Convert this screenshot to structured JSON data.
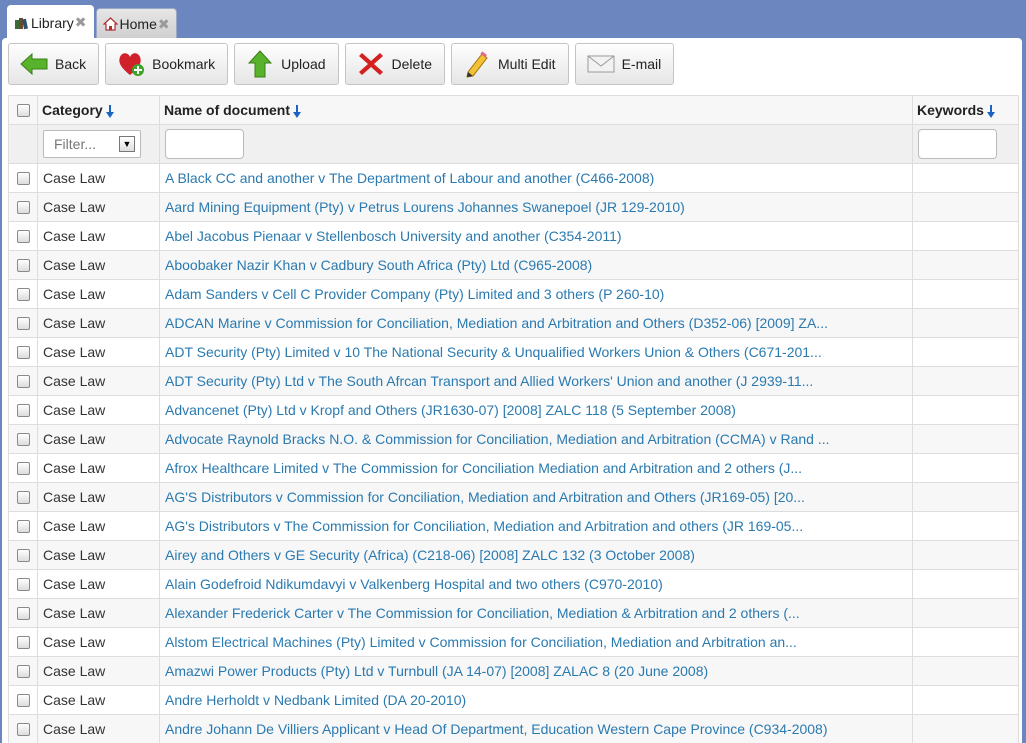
{
  "tabs": [
    {
      "label": "Library",
      "icon": "books-icon",
      "active": true
    },
    {
      "label": "Home",
      "icon": "house-icon",
      "active": false
    }
  ],
  "toolbar": [
    {
      "label": "Back",
      "icon": "back-arrow-icon"
    },
    {
      "label": "Bookmark",
      "icon": "heart-add-icon"
    },
    {
      "label": "Upload",
      "icon": "upload-arrow-icon"
    },
    {
      "label": "Delete",
      "icon": "delete-x-icon"
    },
    {
      "label": "Multi Edit",
      "icon": "pencil-icon"
    },
    {
      "label": "E-mail",
      "icon": "envelope-icon"
    }
  ],
  "table": {
    "headers": {
      "category": "Category",
      "name": "Name of document",
      "keywords": "Keywords"
    },
    "filter_placeholder": "Filter...",
    "rows": [
      {
        "category": "Case Law",
        "name": "A Black CC and another v The Department of Labour and another (C466-2008)"
      },
      {
        "category": "Case Law",
        "name": "Aard Mining Equipment (Pty) v Petrus Lourens Johannes Swanepoel (JR 129-2010)"
      },
      {
        "category": "Case Law",
        "name": "Abel Jacobus Pienaar v Stellenbosch University and another (C354-2011)"
      },
      {
        "category": "Case Law",
        "name": "Aboobaker Nazir Khan v Cadbury South Africa (Pty) Ltd (C965-2008)"
      },
      {
        "category": "Case Law",
        "name": "Adam Sanders v Cell C Provider Company (Pty) Limited and 3 others (P 260-10)"
      },
      {
        "category": "Case Law",
        "name": "ADCAN Marine v Commission for Conciliation, Mediation and Arbitration and Others (D352-06) [2009] ZA..."
      },
      {
        "category": "Case Law",
        "name": "ADT Security (Pty) Limited v 10 The National Security & Unqualified Workers Union & Others (C671-201..."
      },
      {
        "category": "Case Law",
        "name": "ADT Security (Pty) Ltd v The South Afrcan Transport and Allied Workers' Union and another (J 2939-11..."
      },
      {
        "category": "Case Law",
        "name": "Advancenet (Pty) Ltd v Kropf and Others (JR1630-07) [2008] ZALC 118 (5 September 2008)"
      },
      {
        "category": "Case Law",
        "name": "Advocate Raynold Bracks N.O. & Commission for Conciliation, Mediation and Arbitration (CCMA) v Rand ..."
      },
      {
        "category": "Case Law",
        "name": "Afrox Healthcare Limited v The Commission for Conciliation Mediation and Arbitration and 2 others (J..."
      },
      {
        "category": "Case Law",
        "name": "AG'S Distributors v Commission for Conciliation, Mediation and Arbitration and Others (JR169-05) [20..."
      },
      {
        "category": "Case Law",
        "name": "AG's Distributors v The Commission for Conciliation, Mediation and Arbitration and others (JR 169-05..."
      },
      {
        "category": "Case Law",
        "name": "Airey and Others v GE Security (Africa) (C218-06) [2008] ZALC 132 (3 October 2008)"
      },
      {
        "category": "Case Law",
        "name": "Alain Godefroid Ndikumdavyi v Valkenberg Hospital and two others (C970-2010)"
      },
      {
        "category": "Case Law",
        "name": "Alexander Frederick Carter v The Commission for Conciliation, Mediation & Arbitration and 2 others (..."
      },
      {
        "category": "Case Law",
        "name": "Alstom Electrical Machines (Pty) Limited v Commission for Conciliation, Mediation and Arbitration an..."
      },
      {
        "category": "Case Law",
        "name": "Amazwi Power Products (Pty) Ltd v Turnbull (JA 14-07) [2008] ZALAC 8 (20 June 2008)"
      },
      {
        "category": "Case Law",
        "name": "Andre Herholdt v Nedbank Limited (DA 20-2010)"
      },
      {
        "category": "Case Law",
        "name": "Andre Johann De Villiers Applicant v Head Of Department, Education Western Cape Province (C934-2008)"
      }
    ]
  }
}
